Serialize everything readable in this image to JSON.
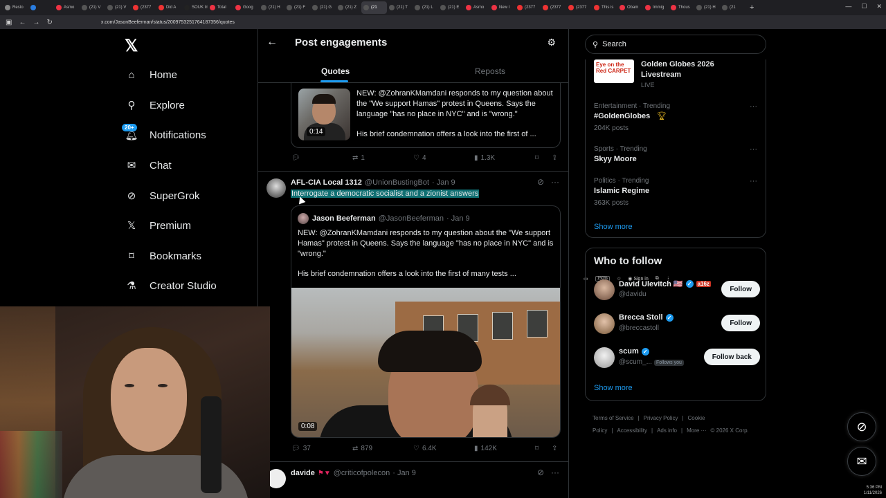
{
  "browser": {
    "tabs": [
      {
        "label": "Resto",
        "color": "#888"
      },
      {
        "label": "",
        "color": "#2a7de1"
      },
      {
        "label": "Asmo",
        "color": "#e34"
      },
      {
        "label": "(21) V",
        "color": "#555"
      },
      {
        "label": "(21) V",
        "color": "#555"
      },
      {
        "label": "(2377",
        "color": "#e33"
      },
      {
        "label": "Did A",
        "color": "#e33"
      },
      {
        "label": "SOUK Inte",
        "color": "#222"
      },
      {
        "label": "Total",
        "color": "#e34"
      },
      {
        "label": "Goog",
        "color": "#e34"
      },
      {
        "label": "(21) H",
        "color": "#555"
      },
      {
        "label": "(21) F",
        "color": "#555"
      },
      {
        "label": "(21) G",
        "color": "#555"
      },
      {
        "label": "(21) Z",
        "color": "#555"
      },
      {
        "label": "(21",
        "color": "#555"
      },
      {
        "label": "(21) T",
        "color": "#555"
      },
      {
        "label": "(21) L",
        "color": "#555"
      },
      {
        "label": "(21) E",
        "color": "#555"
      },
      {
        "label": "Asmo",
        "color": "#e34"
      },
      {
        "label": "New I",
        "color": "#e34"
      },
      {
        "label": "(2377",
        "color": "#e33"
      },
      {
        "label": "(2377",
        "color": "#e33"
      },
      {
        "label": "(2377",
        "color": "#e33"
      },
      {
        "label": "This is",
        "color": "#e33"
      },
      {
        "label": "Obam",
        "color": "#e34"
      },
      {
        "label": "Immig",
        "color": "#e34"
      },
      {
        "label": "Thous",
        "color": "#e34"
      },
      {
        "label": "(21) H",
        "color": "#555"
      },
      {
        "label": "(21",
        "color": "#555"
      }
    ],
    "active_tab_index": 14,
    "url": "x.com/JasonBeeferman/status/2009753251764187356/quotes",
    "zoom": "150%",
    "sign_in": "Sign in"
  },
  "leftnav": {
    "items": [
      {
        "label": "Home",
        "icon": "home-icon",
        "glyph": "⌂"
      },
      {
        "label": "Explore",
        "icon": "search-icon",
        "glyph": "⚲"
      },
      {
        "label": "Notifications",
        "icon": "bell-icon",
        "glyph": "🔔︎"
      },
      {
        "label": "Chat",
        "icon": "mail-icon",
        "glyph": "✉"
      },
      {
        "label": "SuperGrok",
        "icon": "grok-icon",
        "glyph": "⊘"
      },
      {
        "label": "Premium",
        "icon": "x-logo-icon",
        "glyph": "𝕏"
      },
      {
        "label": "Bookmarks",
        "icon": "bookmark-icon",
        "glyph": "⌑"
      },
      {
        "label": "Creator Studio",
        "icon": "flask-icon",
        "glyph": "⚗"
      }
    ],
    "notification_badge": "20+"
  },
  "header": {
    "title": "Post engagements",
    "tabs": [
      "Quotes",
      "Reposts"
    ]
  },
  "top_quoted": {
    "duration": "0:14",
    "text": "NEW: @ZohranKMamdani responds to my question about the \"We support Hamas\" protest in Queens. Says the language \"has no place in NYC\" and is \"wrong.\"",
    "text2": "His brief condemnation offers a look into the first of ...",
    "replies": "",
    "reposts": "1",
    "likes": "4",
    "views": "1.3K"
  },
  "post": {
    "name": "AFL-CIA Local 1312",
    "handle": "@UnionBustingBot",
    "date": "· Jan 9",
    "text": "Interrogate a democratic socialist and a zionist answers",
    "quote": {
      "name": "Jason Beeferman",
      "handle": "@JasonBeeferman",
      "date": "· Jan 9",
      "text": "NEW: @ZohranKMamdani responds to my question about the \"We support Hamas\" protest in Queens. Says the language \"has no place in NYC\" and is \"wrong.\"",
      "text2": "His brief condemnation offers a look into the first of many tests ...",
      "duration": "0:08"
    },
    "replies": "37",
    "reposts": "879",
    "likes": "6.4K",
    "views": "142K"
  },
  "next_post": {
    "name": "davide",
    "handle": "@criticofpolecon",
    "date": "· Jan 9"
  },
  "right": {
    "search_placeholder": "Search",
    "live": {
      "title_line1": "Golden Globes 2026",
      "title_line2": "Livestream",
      "status": "LIVE",
      "logo_text": "Eye on the Red CARPET"
    },
    "trends": [
      {
        "category": "Entertainment · Trending",
        "name": "#GoldenGlobes",
        "count": "204K posts"
      },
      {
        "category": "Sports · Trending",
        "name": "Skyy Moore",
        "count": ""
      },
      {
        "category": "Politics · Trending",
        "name": "Islamic Regime",
        "count": "363K posts"
      }
    ],
    "show_more": "Show more",
    "who_to_follow_title": "Who to follow",
    "follow": [
      {
        "name": "David Ulevitch 🇺🇸",
        "handle": "@davidu",
        "button": "Follow",
        "follows_you": ""
      },
      {
        "name": "Brecca Stoll",
        "handle": "@breccastoll",
        "button": "Follow",
        "follows_you": ""
      },
      {
        "name": "scum",
        "handle": "@scum_...",
        "button": "Follow back",
        "follows_you": "Follows you"
      }
    ],
    "show_more_2": "Show more",
    "footer": [
      "Terms of Service",
      "|",
      "Privacy Policy",
      "|",
      "Cookie Policy",
      "|",
      "Accessibility",
      "|",
      "Ads info",
      "|",
      "More ···",
      "© 2026 X Corp."
    ]
  },
  "system": {
    "time": "5:36 PM",
    "date": "1/11/2026"
  },
  "colors": {
    "accent": "#1d9bf0",
    "highlight": "#0f6f72",
    "background": "#000000",
    "border": "#2f3336"
  }
}
